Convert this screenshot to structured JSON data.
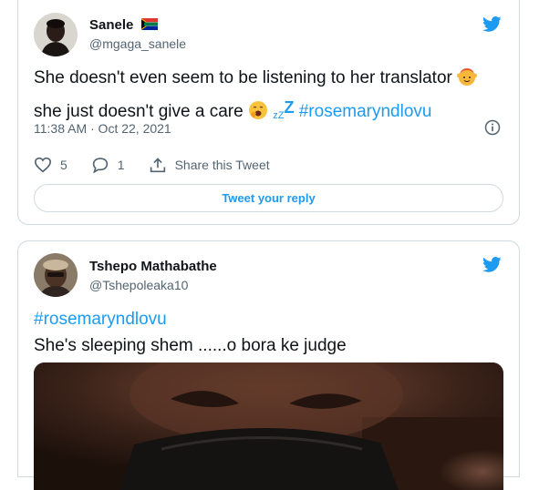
{
  "tweet1": {
    "author_name": "Sanele",
    "author_flag": "south-africa-flag",
    "handle": "@mgaga_sanele",
    "text_line1": "She doesn't even seem to be listening to her translator",
    "text_line1_emoji": "person-gesturing-ok-emoji",
    "text_line2": "she just doesn't give a care",
    "text_line2_emoji": "yawning-face-emoji",
    "zzz": "zZ",
    "zzz_big": "Z",
    "hashtag": "#rosemaryndlovu",
    "timestamp": "11:38 AM · Oct 22, 2021",
    "likes": "5",
    "replies": "1",
    "share_label": "Share this Tweet",
    "reply_button_label": "Tweet your reply"
  },
  "tweet2": {
    "author_name": "Tshepo Mathabathe",
    "handle": "@Tshepoleaka10",
    "hashtag": "#rosemaryndlovu",
    "text": "She's sleeping shem ......o bora ke judge",
    "media": "photo"
  },
  "colors": {
    "accent": "#1d9bf0",
    "text": "#0f1419",
    "secondary": "#536471",
    "border": "#cfd9de"
  }
}
